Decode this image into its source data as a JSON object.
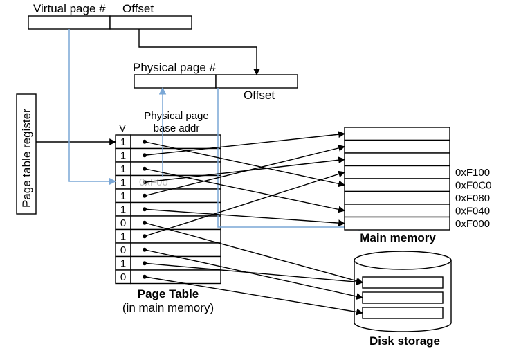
{
  "virtualAddress": {
    "label1": "Virtual page #",
    "label2": "Offset"
  },
  "physicalAddress": {
    "title": "Physical page #",
    "offsetLabel": "Offset"
  },
  "pageTableRegister": "Page table register",
  "pageTable": {
    "colV": "V",
    "colPhys1": "Physical page",
    "colPhys2": "base addr",
    "rows": [
      "1",
      "1",
      "1",
      "1",
      "1",
      "1",
      "0",
      "1",
      "0",
      "1",
      "0"
    ],
    "fadedEntry": "0xF00",
    "caption1": "Page Table",
    "caption2": "(in main memory)"
  },
  "mainMemory": {
    "title": "Main memory",
    "addresses": [
      "0xF100",
      "0xF0C0",
      "0xF080",
      "0xF040",
      "0xF000"
    ]
  },
  "diskStorage": {
    "title": "Disk storage"
  }
}
